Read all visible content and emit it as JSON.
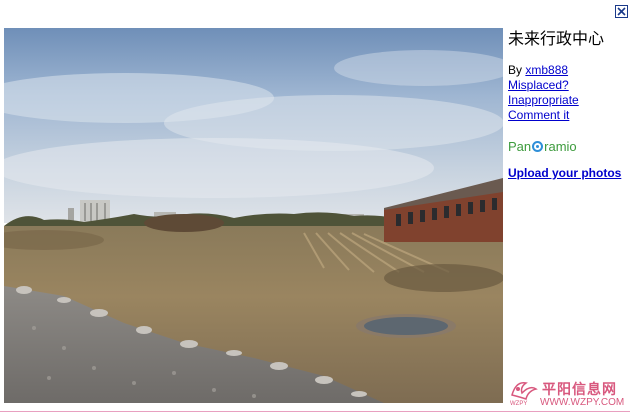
{
  "window": {
    "close_icon": "close-x-icon"
  },
  "photo": {
    "alt_subject": "field landscape photo"
  },
  "info": {
    "title": "未来行政中心",
    "by_prefix": "By ",
    "author": "xmb888",
    "misplaced": "Misplaced?",
    "inappropriate": "Inappropriate",
    "comment": "Comment it",
    "upload": "Upload your photos"
  },
  "logo": {
    "text_before": "Pan",
    "text_after": "ramio"
  },
  "watermark": {
    "site_name": "平阳信息网",
    "url": "WWW.WZPY.COM",
    "small": "WZPY"
  },
  "colors": {
    "link": "#0000cc",
    "logo_green": "#3d9b3d",
    "logo_blue": "#2f8fd8",
    "watermark_pink": "#d8587e"
  }
}
